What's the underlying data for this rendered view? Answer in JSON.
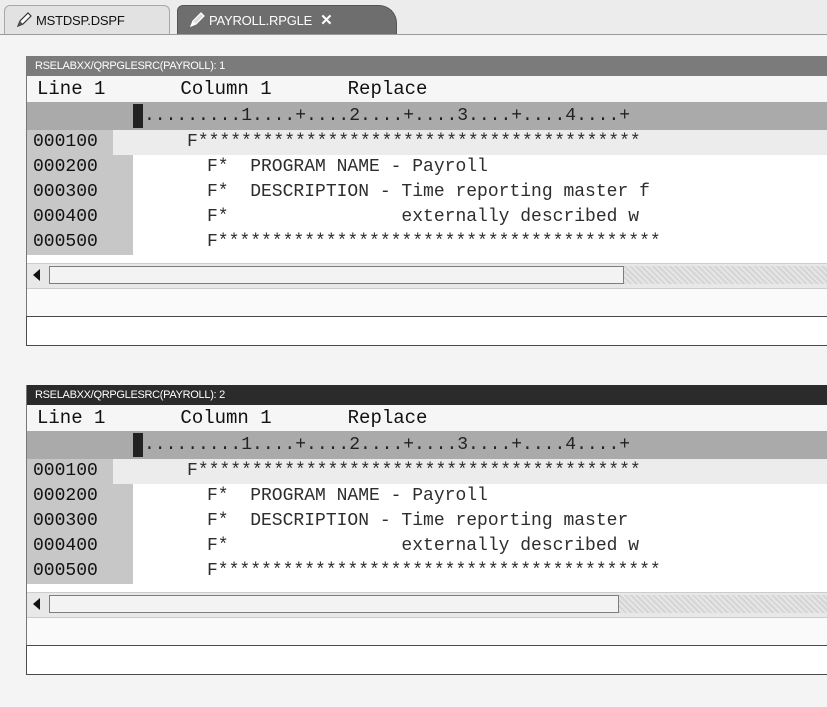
{
  "tabs": [
    {
      "label": "MSTDSP.DSPF",
      "active": false
    },
    {
      "label": "PAYROLL.RPGLE",
      "active": true,
      "close": "✕"
    }
  ],
  "panes": [
    {
      "header": "RSELABXX/QRPGLESRC(PAYROLL): 1",
      "status": {
        "line_label": "Line 1",
        "column_label": "Column 1",
        "mode": "Replace"
      },
      "ruler": ".........1....+....2....+....3....+....4....+",
      "rows": [
        {
          "seq": "000100",
          "src": "F*****************************************"
        },
        {
          "seq": "000200",
          "src": "F*  PROGRAM NAME - Payroll"
        },
        {
          "seq": "000300",
          "src": "F*  DESCRIPTION - Time reporting master f"
        },
        {
          "seq": "000400",
          "src": "F*                externally described w"
        },
        {
          "seq": "000500",
          "src": "F*****************************************"
        }
      ]
    },
    {
      "header": "RSELABXX/QRPGLESRC(PAYROLL): 2",
      "status": {
        "line_label": "Line 1",
        "column_label": "Column 1",
        "mode": "Replace"
      },
      "ruler": ".........1....+....2....+....3....+....4....+",
      "rows": [
        {
          "seq": "000100",
          "src": "F*****************************************"
        },
        {
          "seq": "000200",
          "src": "F*  PROGRAM NAME - Payroll"
        },
        {
          "seq": "000300",
          "src": "F*  DESCRIPTION - Time reporting master"
        },
        {
          "seq": "000400",
          "src": "F*                externally described w"
        },
        {
          "seq": "000500",
          "src": "F*****************************************"
        }
      ]
    }
  ],
  "icons": {
    "tab_file": "pencil-icon",
    "close": "close-icon",
    "scroll_left": "scroll-left-arrow-icon"
  }
}
